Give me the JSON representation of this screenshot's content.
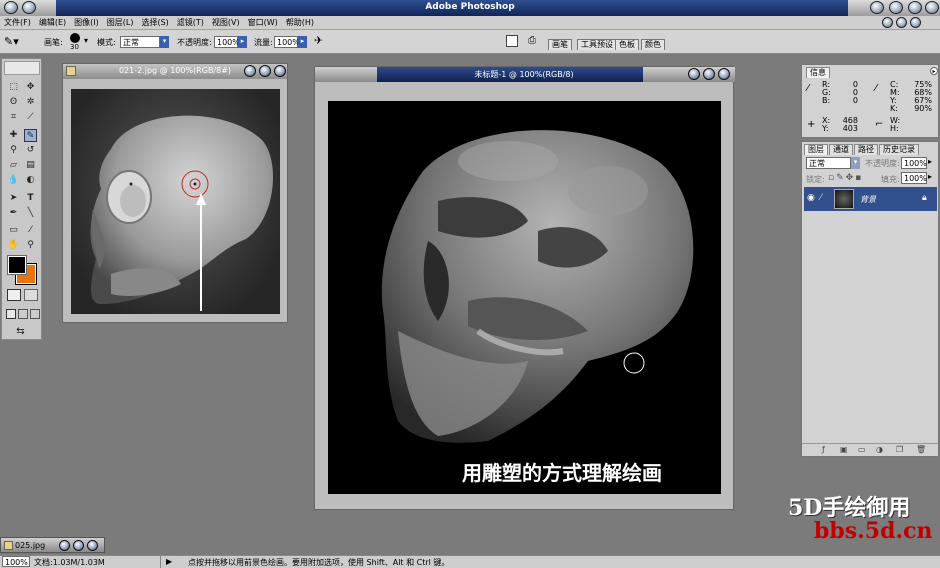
{
  "app": {
    "title": "Adobe Photoshop"
  },
  "menu": [
    "文件(F)",
    "编辑(E)",
    "图像(I)",
    "图层(L)",
    "选择(S)",
    "滤镜(T)",
    "视图(V)",
    "窗口(W)",
    "帮助(H)"
  ],
  "options": {
    "brush_label": "画笔:",
    "brush_size": "30",
    "mode_label": "模式:",
    "mode_value": "正常",
    "opacity_label": "不透明度:",
    "opacity_value": "100%",
    "flow_label": "流量:",
    "flow_value": "100%"
  },
  "palette_well_tabs": [
    "画笔",
    "工具预设",
    "色板",
    "颜色"
  ],
  "doc1": {
    "title": "021-2.jpg @ 100%(RGB/8#)"
  },
  "doc2": {
    "title": "未标题-1 @ 100%(RGB/8)",
    "caption": "用雕塑的方式理解绘画"
  },
  "doc3": {
    "title": "025.jpg"
  },
  "info_panel": {
    "tab": "信息",
    "r_label": "R:",
    "r_value": "0",
    "g_label": "G:",
    "g_value": "0",
    "b_label": "B:",
    "b_value": "0",
    "c_label": "C:",
    "c_value": "75%",
    "m_label": "M:",
    "m_value": "68%",
    "y_label": "Y:",
    "y_value": "67%",
    "k_label": "K:",
    "k_value": "90%",
    "x_label": "X:",
    "x_value": "468",
    "yy_label": "Y:",
    "yy_value": "403",
    "w_label": "W:",
    "h_label": "H:"
  },
  "layers_panel": {
    "tabs": [
      "图层",
      "通道",
      "路径",
      "历史记录"
    ],
    "blend_mode": "正常",
    "opacity_label": "不透明度:",
    "opacity_value": "100%",
    "lock_label": "锁定:",
    "fill_label": "填充:",
    "fill_value": "100%",
    "layer_name": "背景"
  },
  "status": {
    "zoom": "100%",
    "doc_size": "文档:1.03M/1.03M",
    "hint": "点按并拖移以用前景色绘画。要用附加选项，使用 Shift、Alt 和 Ctrl 键。"
  },
  "watermark": {
    "line1": "5D手绘御用",
    "line2": "bbs.5d.cn"
  },
  "colors": {
    "foreground": "#000000",
    "background": "#e8740c",
    "titlebar": "#1d3570",
    "watermark_red": "#c00000"
  }
}
